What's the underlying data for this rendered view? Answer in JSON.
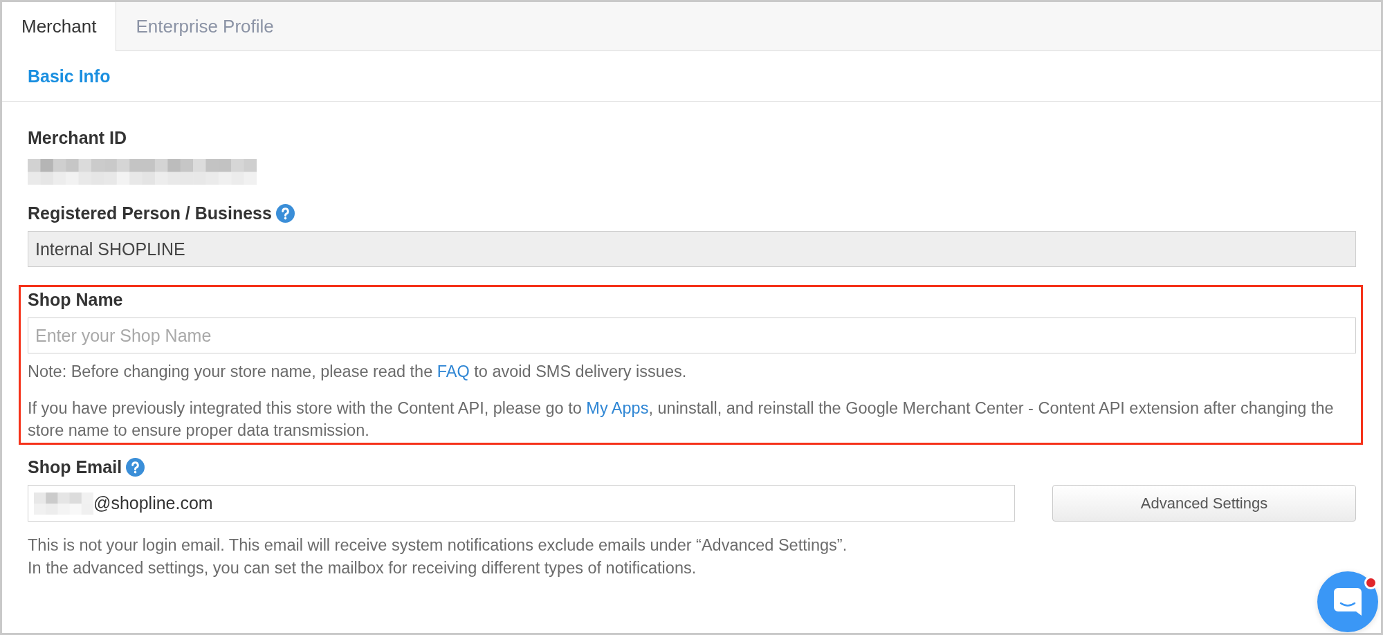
{
  "tabs": [
    {
      "label": "Merchant",
      "selected": true
    },
    {
      "label": "Enterprise Profile",
      "selected": false
    }
  ],
  "section": {
    "title": "Basic Info"
  },
  "fields": [
    {
      "kind": "redacted",
      "label": "Merchant ID",
      "help": false,
      "highlighted": false
    },
    {
      "kind": "input",
      "label": "Registered Person / Business",
      "help": true,
      "highlighted": false,
      "value": "Internal SHOPLINE",
      "disabled": true
    },
    {
      "kind": "input",
      "label": "Shop Name",
      "help": false,
      "highlighted": true,
      "placeholder": "Enter your Shop Name",
      "disabled": false,
      "notes": [
        [
          {
            "text": "Note: Before changing your store name, please read the "
          },
          {
            "text": "FAQ",
            "kind": "link"
          },
          {
            "text": " to avoid SMS delivery issues."
          }
        ],
        [
          {
            "text": "If you have previously integrated this store with the Content API, please go to "
          },
          {
            "text": "My Apps",
            "kind": "link"
          },
          {
            "text": ", uninstall, and reinstall the Google Merchant Center - Content API extension after changing the store name to ensure proper data transmission."
          }
        ]
      ]
    },
    {
      "kind": "email",
      "label": "Shop Email",
      "help": true,
      "highlighted": false,
      "value": "@shopline.com",
      "disabled": false,
      "button": "Advanced Settings",
      "hint_lines": [
        "This is not your login email. This email will receive system notifications exclude emails under “Advanced Settings”.",
        "In the advanced settings, you can set the mailbox for receiving different types of notifications."
      ]
    }
  ],
  "chat": {
    "unread": true
  }
}
